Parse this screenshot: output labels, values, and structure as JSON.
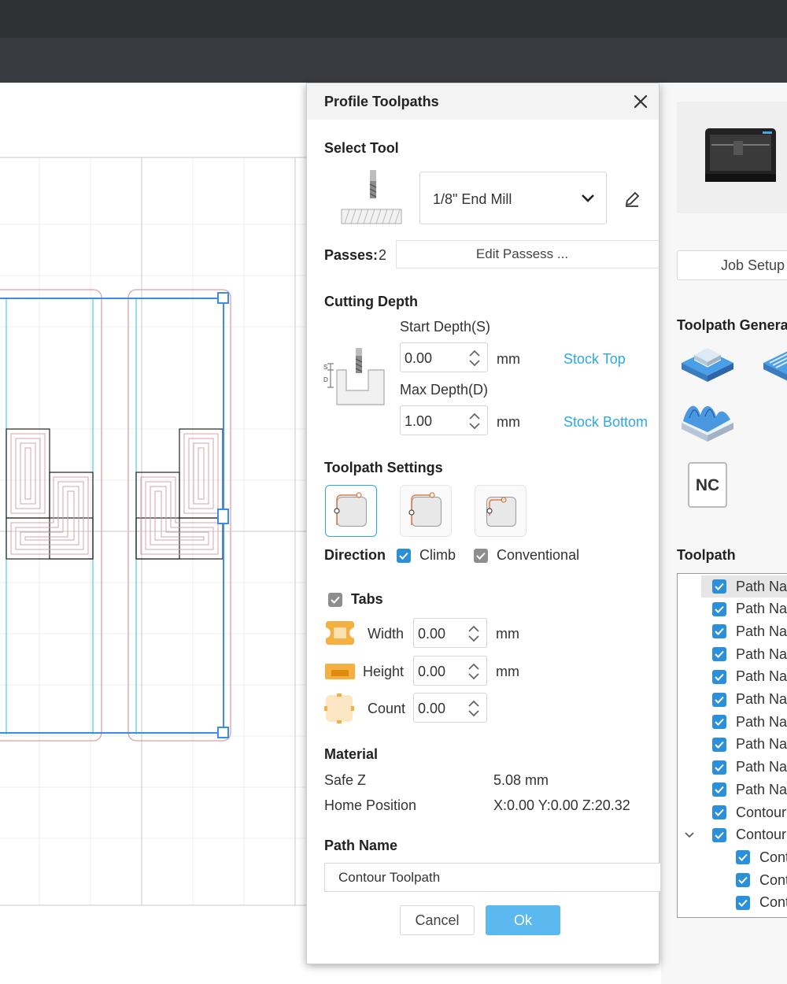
{
  "dialog": {
    "title": "Profile Toolpaths",
    "select_tool": {
      "heading": "Select Tool",
      "tool_value": "1/8\" End Mill"
    },
    "passes": {
      "label": "Passes:",
      "value": "2",
      "edit_button": "Edit Passess ..."
    },
    "cutting_depth": {
      "heading": "Cutting Depth",
      "start_label": "Start Depth(S)",
      "start_value": "0.00",
      "start_unit": "mm",
      "start_link": "Stock Top",
      "max_label": "Max Depth(D)",
      "max_value": "1.00",
      "max_unit": "mm",
      "max_link": "Stock Bottom"
    },
    "toolpath_settings": {
      "heading": "Toolpath Settings",
      "direction_label": "Direction",
      "climb_label": "Climb",
      "climb_checked": true,
      "conventional_label": "Conventional",
      "conventional_checked": true
    },
    "tabs": {
      "label": "Tabs",
      "checked": true,
      "width_label": "Width",
      "width_value": "0.00",
      "width_unit": "mm",
      "height_label": "Height",
      "height_value": "0.00",
      "height_unit": "mm",
      "count_label": "Count",
      "count_value": "0.00"
    },
    "material": {
      "heading": "Material",
      "safe_z_label": "Safe Z",
      "safe_z_value": "5.08 mm",
      "home_label": "Home Position",
      "home_value": "X:0.00 Y:0.00 Z:20.32"
    },
    "path_name": {
      "heading": "Path Name",
      "value": "Contour Toolpath"
    },
    "cancel_label": "Cancel",
    "ok_label": "Ok"
  },
  "right_panel": {
    "job_setup_label": "Job Setup",
    "generator_title": "Toolpath Genera",
    "nc_label": "NC",
    "toolpath_title": "Toolpath",
    "tree_items": [
      {
        "label": "Path Nar",
        "level": 0
      },
      {
        "label": "Path Nar",
        "level": 0
      },
      {
        "label": "Path Nar",
        "level": 0
      },
      {
        "label": "Path Nar",
        "level": 0
      },
      {
        "label": "Path Nar",
        "level": 0
      },
      {
        "label": "Path Nar",
        "level": 0
      },
      {
        "label": "Path Nar",
        "level": 0
      },
      {
        "label": "Path Nar",
        "level": 0
      },
      {
        "label": "Path Nar",
        "level": 0
      },
      {
        "label": "Path Nar",
        "level": 0
      },
      {
        "label": "Contour",
        "level": 0
      },
      {
        "label": "Contour",
        "level": 0,
        "expanded": true
      },
      {
        "label": "Cont",
        "level": 1
      },
      {
        "label": "Cont",
        "level": 1
      },
      {
        "label": "Cont",
        "level": 1
      }
    ]
  },
  "colors": {
    "accent": "#2ea8e0",
    "checkbox": "#2b90d9",
    "ok_button": "#5bb9f0",
    "selection": "#3a8ee6",
    "toolpath_red": "#d9a0a8",
    "toolpath_cyan": "#5fd0e0"
  }
}
